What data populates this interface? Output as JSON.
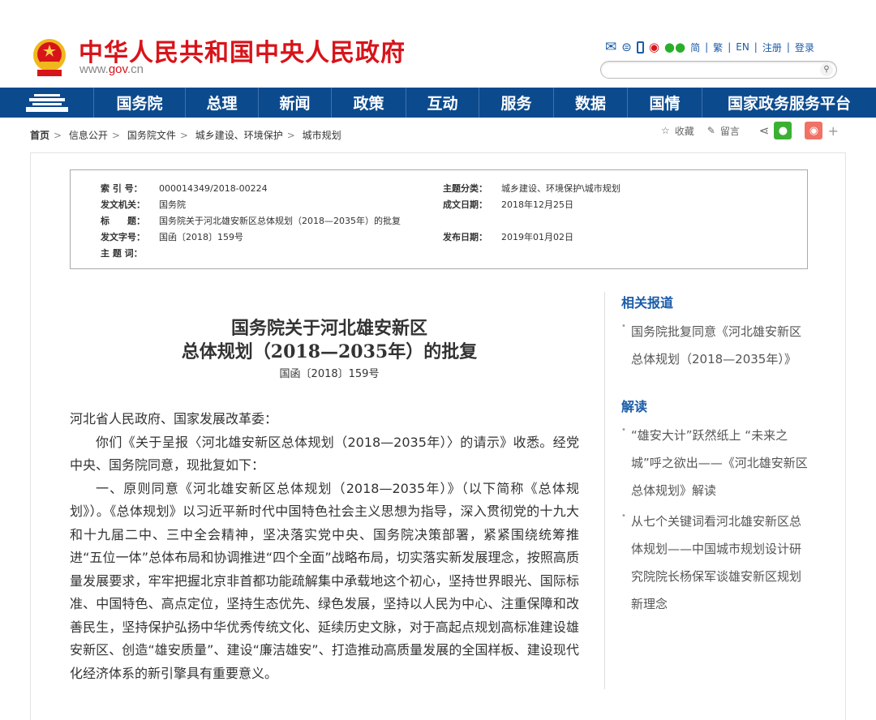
{
  "header": {
    "title": "中华人民共和国中央人民政府",
    "url_prefix": "www.",
    "url_brand": "gov",
    "url_suffix": ".cn",
    "links": [
      "简",
      "繁",
      "EN",
      "注册",
      "登录"
    ],
    "search_placeholder": ""
  },
  "nav": [
    "国务院",
    "总理",
    "新闻",
    "政策",
    "互动",
    "服务",
    "数据",
    "国情",
    "国家政务服务平台"
  ],
  "breadcrumb": [
    "首页",
    "信息公开",
    "国务院文件",
    "城乡建设、环境保护",
    "城市规划"
  ],
  "tools": {
    "favorite": "收藏",
    "comment": "留言",
    "plus": "+"
  },
  "meta": {
    "index_label": "索 引 号：",
    "index": "000014349/2018-00224",
    "category_label": "主题分类：",
    "category": "城乡建设、环境保护\\城市规划",
    "issuer_label": "发文机关：",
    "issuer": "国务院",
    "written_label": "成文日期：",
    "written": "2018年12月25日",
    "title_label": "标　　题：",
    "title": "国务院关于河北雄安新区总体规划（2018—2035年）的批复",
    "docno_label": "发文字号：",
    "docno": "国函〔2018〕159号",
    "published_label": "发布日期：",
    "published": "2019年01月02日",
    "keywords_label": "主 题 词：",
    "keywords": ""
  },
  "document": {
    "title_line1": "国务院关于河北雄安新区",
    "title_line2": "总体规划（2018—2035年）的批复",
    "number": "国函〔2018〕159号",
    "paragraphs": [
      "河北省人民政府、国家发展改革委：",
      "你们《关于呈报〈河北雄安新区总体规划（2018—2035年）〉的请示》收悉。经党中央、国务院同意，现批复如下：",
      "一、原则同意《河北雄安新区总体规划（2018—2035年）》（以下简称《总体规划》）。《总体规划》以习近平新时代中国特色社会主义思想为指导，深入贯彻党的十九大和十九届二中、三中全会精神，坚决落实党中央、国务院决策部署，紧紧围绕统筹推进“五位一体”总体布局和协调推进“四个全面”战略布局，切实落实新发展理念，按照高质量发展要求，牢牢把握北京非首都功能疏解集中承载地这个初心，坚持世界眼光、国际标准、中国特色、高点定位，坚持生态优先、绿色发展，坚持以人民为中心、注重保障和改善民生，坚持保护弘扬中华优秀传统文化、延续历史文脉，对于高起点规划高标准建设雄安新区、创造“雄安质量”、建设“廉洁雄安”、打造推动高质量发展的全国样板、建设现代化经济体系的新引擎具有重要意义。"
    ]
  },
  "sidebar": {
    "related_title": "相关报道",
    "related": [
      "国务院批复同意《河北雄安新区总体规划（2018—2035年）》"
    ],
    "interpret_title": "解读",
    "interpret": [
      "“雄安大计”跃然纸上 “未来之城”呼之欲出——《河北雄安新区总体规划》解读",
      "从七个关键词看河北雄安新区总体规划——中国城市规划设计研究院院长杨保军谈雄安新区规划新理念"
    ]
  },
  "colors": {
    "brand_red": "#d7141a",
    "nav_blue": "#0c4a8e",
    "link_blue": "#1a5ca8"
  }
}
